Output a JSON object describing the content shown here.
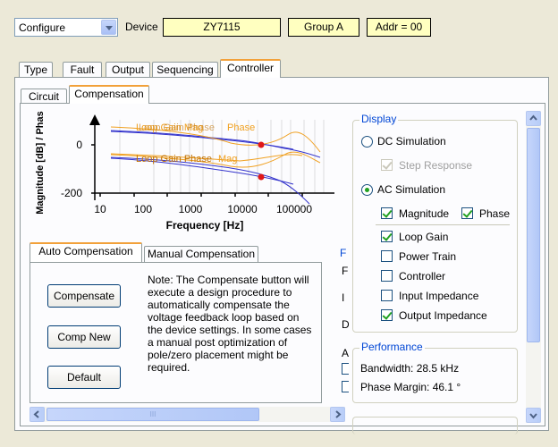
{
  "toolbar": {
    "mode_value": "Configure",
    "device_label": "Device",
    "device_value": "ZY7115",
    "group_value": "Group A",
    "addr_value": "Addr = 00"
  },
  "main_tabs": [
    "Type",
    "Fault",
    "Output",
    "Sequencing",
    "Controller"
  ],
  "sub_tabs": [
    "Circuit",
    "Compensation"
  ],
  "plot": {
    "ylabel": "Magnitude [dB] / Phas",
    "xlabel": "Frequency [Hz]",
    "y_ticks": [
      "0",
      "-200"
    ],
    "x_ticks": [
      "10",
      "100",
      "1000",
      "10000",
      "100000"
    ],
    "legend_top_a": "Loop Gain Mag",
    "legend_top_b": "Loop Gain Phase",
    "legend_top_c": "Phase",
    "legend_bot_a": "Loop Gain Phase",
    "legend_bot_b": "Mag",
    "colors": {
      "mag": "#3333cc",
      "phase": "#f0a020",
      "marker": "#e01818"
    }
  },
  "comp_tabs": [
    "Auto Compensation",
    "Manual Compensation"
  ],
  "buttons": {
    "compensate": "Compensate",
    "comp_new": "Comp New",
    "default": "Default"
  },
  "note": "Note: The Compensate button will execute a design procedure to automatically compensate the voltage feedback loop based on the device settings. In some cases a manual post optimization of pole/zero placement might be required.",
  "hidden_frame": {
    "title": "F",
    "letters": [
      "F",
      "I",
      "D",
      "A"
    ]
  },
  "display": {
    "title": "Display",
    "dc_sim": "DC Simulation",
    "step_response": "Step Response",
    "ac_sim": "AC Simulation",
    "magnitude": "Magnitude",
    "phase": "Phase",
    "loop_gain": "Loop Gain",
    "power_train": "Power Train",
    "controller": "Controller",
    "input_impedance": "Input Impedance",
    "output_impedance": "Output Impedance"
  },
  "performance": {
    "title": "Performance",
    "bandwidth": "Bandwidth: 28.5 kHz",
    "phase_margin": "Phase Margin: 46.1 °"
  },
  "scrollbar": {
    "grip": "III"
  }
}
